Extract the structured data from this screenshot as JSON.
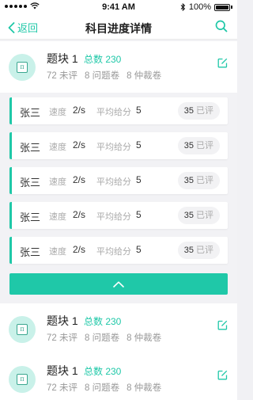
{
  "status_bar": {
    "time": "9:41 AM",
    "battery": "100%",
    "bluetooth_icon": "bluetooth-icon",
    "wifi_icon": "wifi-icon"
  },
  "nav": {
    "back_label": "返回",
    "title": "科目进度详情",
    "search_icon": "search-icon"
  },
  "blocks": [
    {
      "title": "题块 1",
      "total": "总数 230",
      "unreviewed": "72 未评",
      "problem": "8 问题卷",
      "arbitration": "8 仲裁卷"
    },
    {
      "title": "题块 1",
      "total": "总数 230",
      "unreviewed": "72 未评",
      "problem": "8 问题卷",
      "arbitration": "8 仲裁卷"
    },
    {
      "title": "题块 1",
      "total": "总数 230",
      "unreviewed": "72 未评",
      "problem": "8 问题卷",
      "arbitration": "8 仲裁卷"
    }
  ],
  "graders": [
    {
      "name": "张三",
      "speed_label": "速度",
      "speed": "2/s",
      "avg_label": "平均给分",
      "avg": "5",
      "count": "35",
      "count_label": "已评"
    },
    {
      "name": "张三",
      "speed_label": "速度",
      "speed": "2/s",
      "avg_label": "平均给分",
      "avg": "5",
      "count": "35",
      "count_label": "已评"
    },
    {
      "name": "张三",
      "speed_label": "速度",
      "speed": "2/s",
      "avg_label": "平均给分",
      "avg": "5",
      "count": "35",
      "count_label": "已评"
    },
    {
      "name": "张三",
      "speed_label": "速度",
      "speed": "2/s",
      "avg_label": "平均给分",
      "avg": "5",
      "count": "35",
      "count_label": "已评"
    },
    {
      "name": "张三",
      "speed_label": "速度",
      "speed": "2/s",
      "avg_label": "平均给分",
      "avg": "5",
      "count": "35",
      "count_label": "已评"
    }
  ],
  "collapse_icon": "chevron-up-icon",
  "colors": {
    "accent": "#1fc8a8",
    "avatar_bg": "#c9f1e9",
    "muted_text": "#999999",
    "background": "#f1f1f4"
  }
}
